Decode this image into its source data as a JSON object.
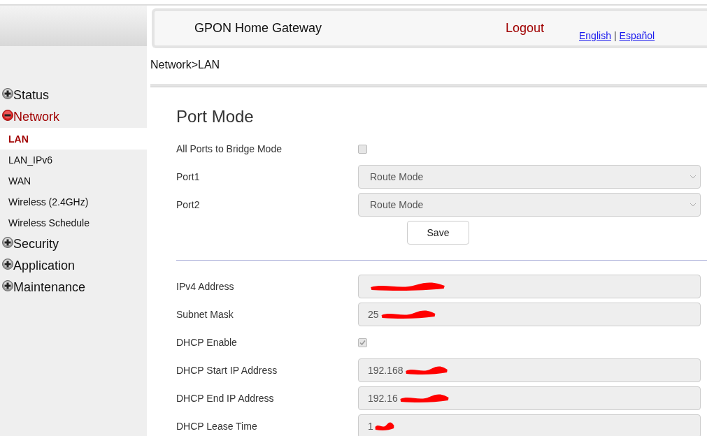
{
  "header": {
    "title": "GPON Home Gateway",
    "logout": "Logout",
    "languages": [
      {
        "label": "English"
      },
      {
        "label": "Español"
      }
    ],
    "separator": "|"
  },
  "breadcrumb": "Network>LAN",
  "sidebar": {
    "groups": [
      {
        "label": "Status",
        "expanded": false
      },
      {
        "label": "Network",
        "expanded": true,
        "children": [
          {
            "label": "LAN",
            "selected": true
          },
          {
            "label": "LAN_IPv6",
            "selected": false
          },
          {
            "label": "WAN",
            "selected": false
          },
          {
            "label": "Wireless (2.4GHz)",
            "selected": false
          },
          {
            "label": "Wireless Schedule",
            "selected": false
          }
        ]
      },
      {
        "label": "Security",
        "expanded": false
      },
      {
        "label": "Application",
        "expanded": false
      },
      {
        "label": "Maintenance",
        "expanded": false
      }
    ]
  },
  "port_mode": {
    "title": "Port Mode",
    "fields": [
      {
        "kind": "checkbox",
        "label": "All Ports to Bridge Mode",
        "checked": false
      },
      {
        "kind": "select",
        "label": "Port1",
        "value": "Route Mode"
      },
      {
        "kind": "select",
        "label": "Port2",
        "value": "Route Mode"
      }
    ],
    "save_button": "Save"
  },
  "lan": {
    "fields": [
      {
        "kind": "text",
        "label": "IPv4 Address",
        "redacted": true
      },
      {
        "kind": "text",
        "label": "Subnet Mask",
        "value": "25",
        "redacted": true
      },
      {
        "kind": "checkbox",
        "label": "DHCP Enable",
        "checked": true
      },
      {
        "kind": "text",
        "label": "DHCP Start IP Address",
        "value": "192.168",
        "redacted": true
      },
      {
        "kind": "text",
        "label": "DHCP End IP Address",
        "value": "192.16",
        "redacted": true
      },
      {
        "kind": "text",
        "label": "DHCP Lease Time",
        "value": "1",
        "redacted": true
      }
    ]
  }
}
